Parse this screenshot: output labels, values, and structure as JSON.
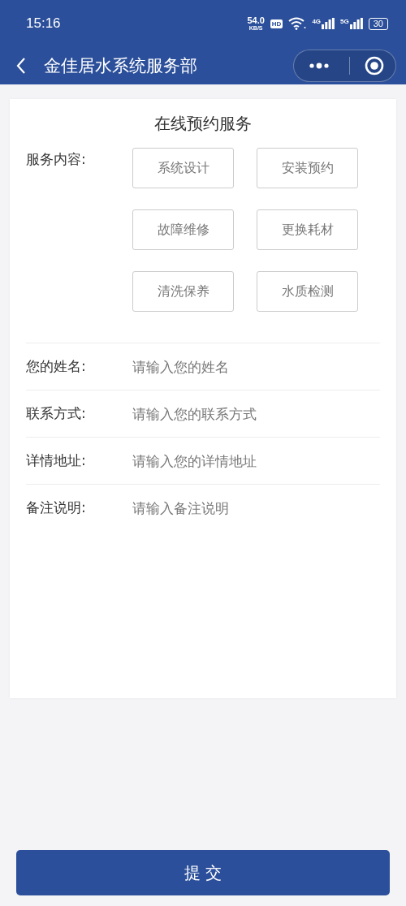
{
  "status_bar": {
    "time": "15:16",
    "speed": "54.0",
    "speed_unit": "KB/S",
    "hd": "HD",
    "networks": [
      "4G",
      "5G"
    ],
    "battery": "30"
  },
  "nav": {
    "title": "金佳居水系统服务部"
  },
  "form": {
    "title": "在线预约服务",
    "service_label": "服务内容:",
    "options": [
      {
        "label": "系统设计",
        "selected": false
      },
      {
        "label": "安装预约",
        "selected": false
      },
      {
        "label": "故障维修",
        "selected": false
      },
      {
        "label": "更换耗材",
        "selected": false
      },
      {
        "label": "清洗保养",
        "selected": false
      },
      {
        "label": "水质检测",
        "selected": false
      }
    ],
    "fields": [
      {
        "label": "您的姓名:",
        "placeholder": "请输入您的姓名"
      },
      {
        "label": "联系方式:",
        "placeholder": "请输入您的联系方式"
      },
      {
        "label": "详情地址:",
        "placeholder": "请输入您的详情地址"
      },
      {
        "label": "备注说明:",
        "placeholder": "请输入备注说明"
      }
    ]
  },
  "submit": "提 交"
}
